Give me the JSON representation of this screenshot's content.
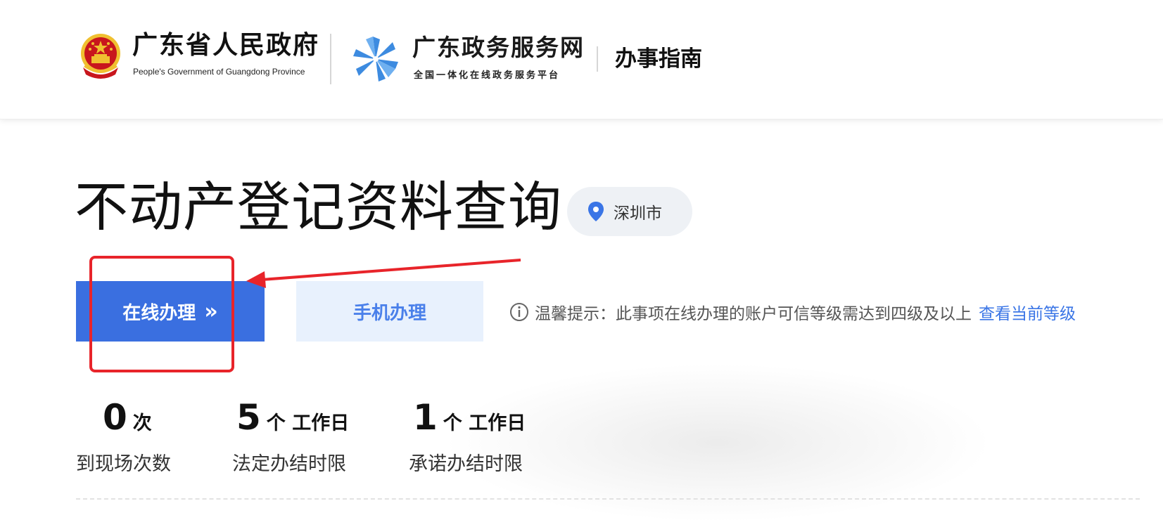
{
  "header": {
    "gov_name": "广东省人民政府",
    "gov_name_en": "People's Government of Guangdong Province",
    "portal_name": "广东政务服务网",
    "portal_subtitle": "全国一体化在线政务服务平台",
    "section_title": "办事指南"
  },
  "service": {
    "title": "不动产登记资料查询",
    "location": "深圳市"
  },
  "actions": {
    "online_label": "在线办理",
    "online_chevron": "»",
    "mobile_label": "手机办理"
  },
  "tip": {
    "text": "温馨提示：此事项在线办理的账户可信等级需达到四级及以上",
    "link": "查看当前等级"
  },
  "stats": [
    {
      "value": "0",
      "unit": "次",
      "label": "到现场次数"
    },
    {
      "value": "5",
      "unit": "个 工作日",
      "label": "法定办结时限"
    },
    {
      "value": "1",
      "unit": "个 工作日",
      "label": "承诺办结时限"
    }
  ],
  "colors": {
    "primary": "#3a6fe0",
    "primary_light": "#e8f1fd",
    "link": "#3a75e6",
    "annotation": "#e8242a",
    "emblem_red": "#c8161d",
    "emblem_gold": "#f0c030",
    "pinwheel_blue": "#3d8be0"
  },
  "icons": {
    "emblem": "national-emblem-icon",
    "portal_logo": "pinwheel-logo-icon",
    "location": "location-pin-icon",
    "info": "info-circle-icon"
  }
}
